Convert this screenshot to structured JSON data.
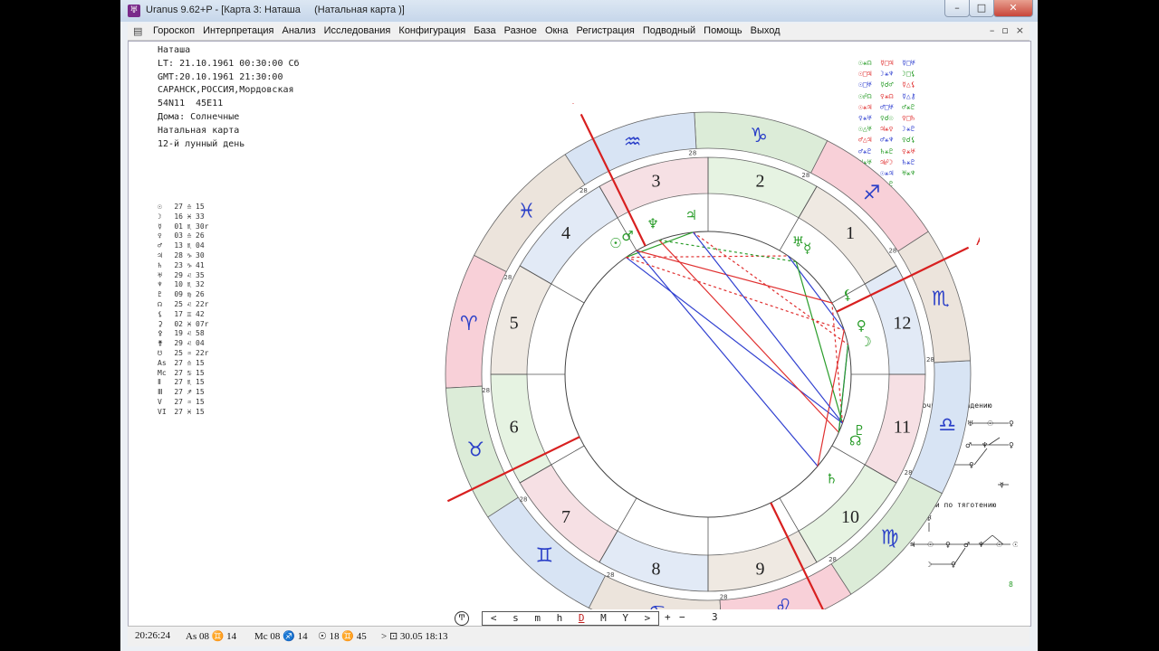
{
  "window": {
    "title": "Uranus 9.62+P - [Карта 3: Наташа     (Натальная карта )]",
    "buttons": {
      "minimize": "–",
      "maximize": "□",
      "close": "✕"
    }
  },
  "menu": {
    "items": [
      "Гороскоп",
      "Интерпретация",
      "Анализ",
      "Исследования",
      "Конфигурация",
      "База",
      "Разное",
      "Окна",
      "Регистрация",
      "Подводный",
      "Помощь",
      "Выход"
    ],
    "mdi": {
      "minimize": "–",
      "restore": "▫",
      "close": "×"
    }
  },
  "info": {
    "lines": [
      "Наташа",
      "LT: 21.10.1961 00:30:00 Сб",
      "GMT:20.10.1961 21:30:00",
      "САРАНСК,РОССИЯ,Мордовская",
      "54N11  45E11",
      "Дома: Солнечные",
      "Натальная карта",
      "12-й лунный день"
    ]
  },
  "planets": [
    {
      "g": "☉",
      "d": "27",
      "s": "♎",
      "m": "15"
    },
    {
      "g": "☽",
      "d": "16",
      "s": "♓",
      "m": "33"
    },
    {
      "g": "☿",
      "d": "01",
      "s": "♏",
      "m": "30r"
    },
    {
      "g": "♀",
      "d": "03",
      "s": "♎",
      "m": "26"
    },
    {
      "g": "♂",
      "d": "13",
      "s": "♏",
      "m": "04"
    },
    {
      "g": "♃",
      "d": "28",
      "s": "♑",
      "m": "30"
    },
    {
      "g": "♄",
      "d": "23",
      "s": "♑",
      "m": "41"
    },
    {
      "g": "♅",
      "d": "29",
      "s": "♌",
      "m": "35"
    },
    {
      "g": "♆",
      "d": "10",
      "s": "♏",
      "m": "32"
    },
    {
      "g": "♇",
      "d": "09",
      "s": "♍",
      "m": "26"
    },
    {
      "g": "☊",
      "d": "25",
      "s": "♌",
      "m": "22r"
    },
    {
      "g": "⚸",
      "d": "17",
      "s": "♊",
      "m": "42"
    },
    {
      "g": "⚳",
      "d": "02",
      "s": "♓",
      "m": "07r"
    },
    {
      "g": "⚴",
      "d": "19",
      "s": "♌",
      "m": "58"
    },
    {
      "g": "⚵",
      "d": "29",
      "s": "♌",
      "m": "04"
    },
    {
      "g": "☋",
      "d": "25",
      "s": "♒",
      "m": "22r"
    },
    {
      "g": "As",
      "d": "27",
      "s": "♎",
      "m": "15"
    },
    {
      "g": "Mc",
      "d": "27",
      "s": "♋",
      "m": "15"
    },
    {
      "g": "Ⅱ",
      "d": "27",
      "s": "♏",
      "m": "15"
    },
    {
      "g": "Ⅲ",
      "d": "27",
      "s": "♐",
      "m": "15"
    },
    {
      "g": "V",
      "d": "27",
      "s": "♒",
      "m": "15"
    },
    {
      "g": "VI",
      "d": "27",
      "s": "♓",
      "m": "15"
    }
  ],
  "aspects": [
    [
      "☉⚹☊",
      "☿□♃",
      "☿□♅"
    ],
    [
      "☉□♃",
      "☽⚹♆",
      "☽□⚸"
    ],
    [
      "☉□♅",
      "☿☌♂",
      "☿△⚸"
    ],
    [
      "☉☍☊",
      "♀⚹☊",
      "☿△⚷"
    ],
    [
      "☉⚹♃",
      "♂□♅",
      "♂⚹♇"
    ],
    [
      "♀⚹♅",
      "♀☌☉",
      "♀□♄"
    ],
    [
      "☉△♅",
      "♃⚹♀",
      "☽⚹♇"
    ],
    [
      "♂△♃",
      "♂⚹♆",
      "♀☌⚸"
    ],
    [
      "♂⚹♇",
      "♄⚹♇",
      "♀⚹♅"
    ],
    [
      "♃⚹♅",
      "♃☍☽",
      "♄⚹♇"
    ],
    [
      "♆⚹♇",
      "☉⚹♃",
      "♅⚹♆"
    ],
    [
      "♆△⚸",
      "♂⚹♇",
      ""
    ]
  ],
  "chains": {
    "ownership_title": "Цепочки по владению",
    "trend_title": "Цепочки по тяготению",
    "count": "8"
  },
  "chart": {
    "signs": [
      "♈",
      "♉",
      "♊",
      "♋",
      "♌",
      "♍",
      "♎",
      "♏",
      "♐",
      "♑",
      "♒",
      "♓"
    ],
    "houses": [
      "1",
      "2",
      "3",
      "4",
      "5",
      "6",
      "7",
      "8",
      "9",
      "10",
      "11",
      "12"
    ],
    "angles": {
      "as": "As",
      "mc": "Mc"
    },
    "cusp_degree": "28",
    "aspect_colors": {
      "harmonic": "#2a9d2a",
      "tense": "#e03030",
      "neutral": "#3040d0"
    },
    "sign_colors": [
      "#f8d0d8",
      "#dcecd8",
      "#d8e4f4",
      "#ece4dc"
    ]
  },
  "navbar": {
    "left_icon": "Ͳ",
    "items": [
      "<",
      "s",
      "m",
      "h",
      "D",
      "M",
      "Y",
      ">"
    ],
    "active": "D",
    "plus": "+",
    "minus": "−",
    "step": "3"
  },
  "status": {
    "time": "20:26:24",
    "as": "As 08 ♊ 14",
    "mc": "Mc 08 ♐ 14",
    "sun": "☉ 18 ♊ 45",
    "date": "> ⊡ 30.05 18:13"
  }
}
